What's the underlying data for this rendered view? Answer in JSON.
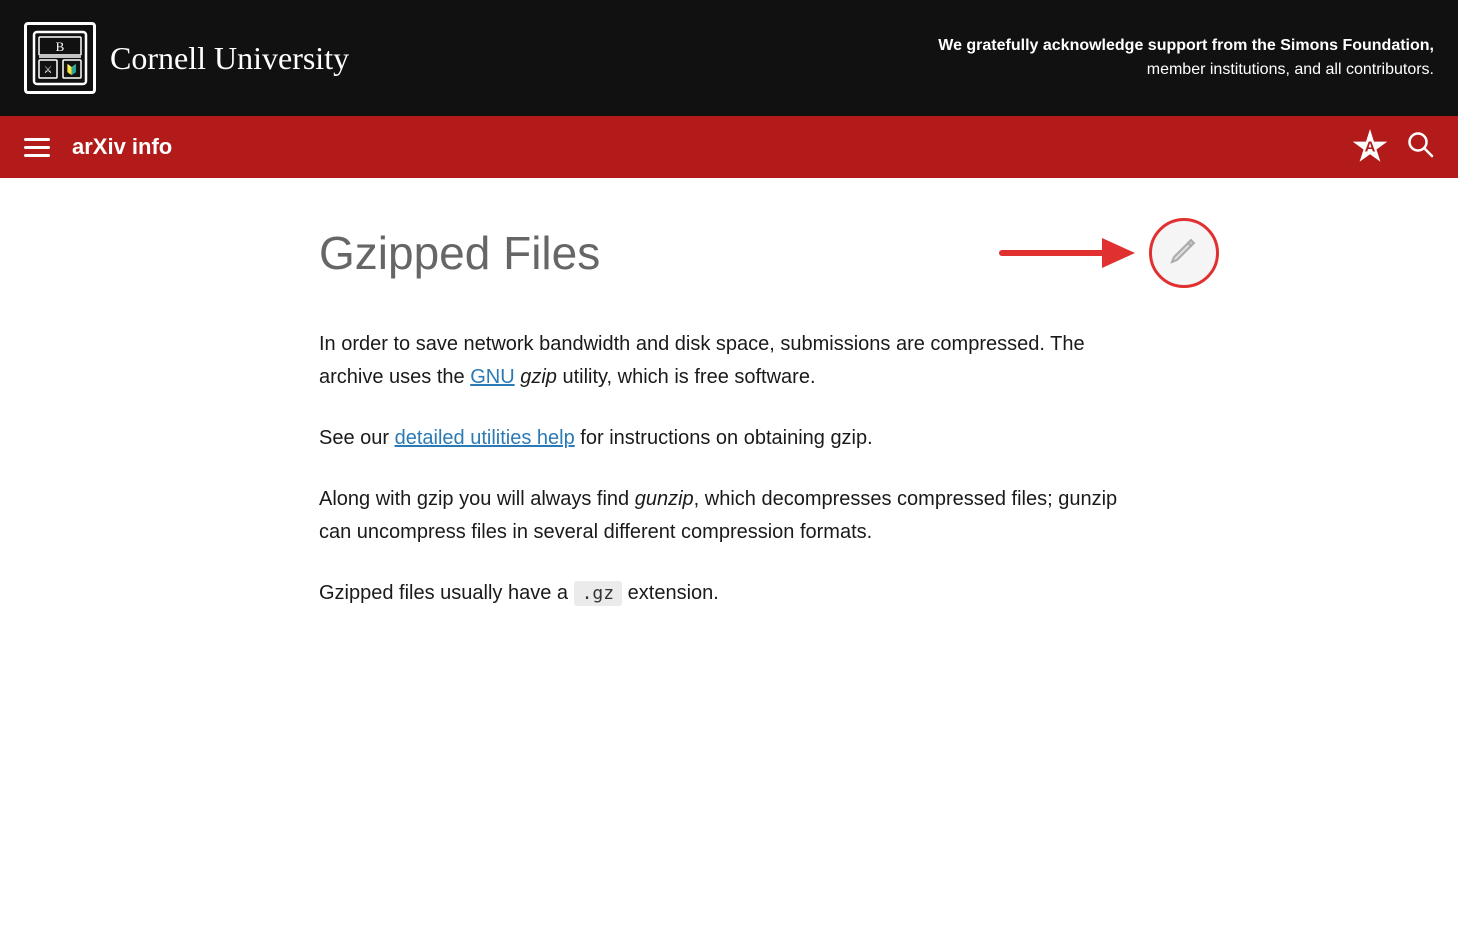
{
  "banner": {
    "university_name": "Cornell University",
    "tagline_line1": "We gratefully acknowledge support from the Simons Foundation,",
    "tagline_line2": "member institutions, and all contributors."
  },
  "nav": {
    "title": "arXiv info",
    "theme_icon_label": "A",
    "search_label": "Search"
  },
  "page": {
    "title": "Gzipped Files",
    "edit_button_label": "Edit",
    "paragraph1_text1": "In order to save network bandwidth and disk space, submissions are compressed. The archive uses the ",
    "paragraph1_link": "GNU",
    "paragraph1_text2": " gzip utility, which is free software.",
    "paragraph2_text1": "See our ",
    "paragraph2_link": "detailed utilities help",
    "paragraph2_text2": " for instructions on obtaining gzip.",
    "paragraph3": "Along with gzip you will always find gunzip, which decompresses compressed files; gunzip can uncompress files in several different compression formats.",
    "paragraph4_text1": "Gzipped files usually have a ",
    "paragraph4_code": ".gz",
    "paragraph4_text2": " extension."
  }
}
